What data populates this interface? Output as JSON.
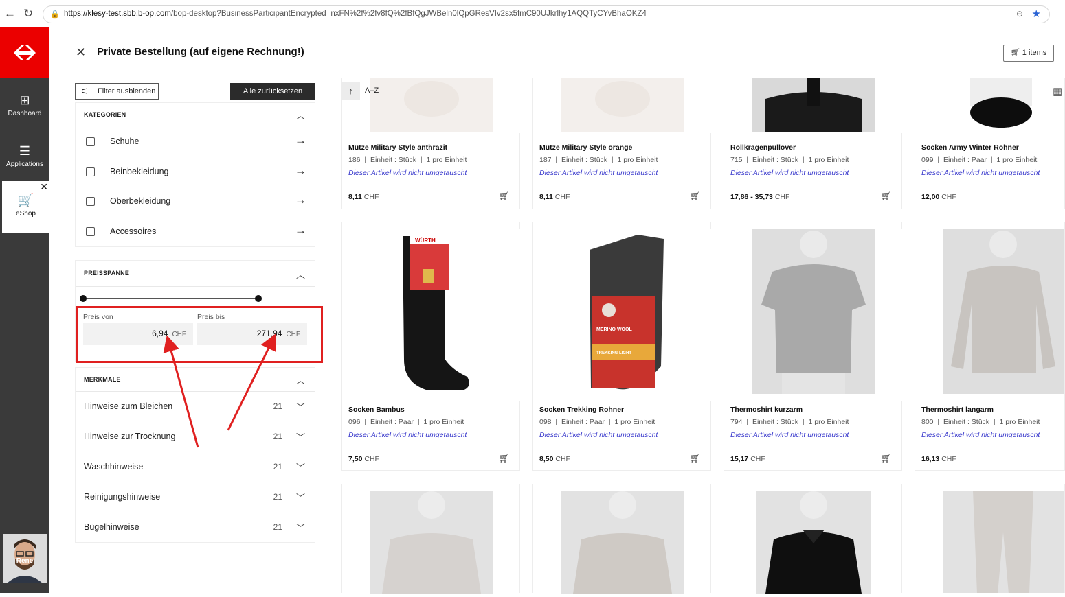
{
  "browser": {
    "url_host": "https://klesy-test.sbb.b-op.com",
    "url_path": "/bop-desktop?BusinessParticipantEncrypted=nxFN%2f%2fv8fQ%2fBfQgJWBeln0lQpGResVIv2sx5fmC90UJkrlhy1AQQTyCYvBhaOKZ4"
  },
  "rail": {
    "items": [
      {
        "label": "Dashboard",
        "icon": "dashboard-icon"
      },
      {
        "label": "Applications",
        "icon": "menu-icon"
      }
    ],
    "active": {
      "label": "eShop",
      "icon": "cart-icon"
    },
    "user": "Rene"
  },
  "header": {
    "title": "Private Bestellung (auf eigene Rechnung!)",
    "cart_label": "1 items"
  },
  "filters": {
    "toggle_label": "Filter ausblenden",
    "reset_label": "Alle zurücksetzen",
    "categories": {
      "title": "KATEGORIEN",
      "items": [
        "Schuhe",
        "Beinbekleidung",
        "Oberbekleidung",
        "Accessoires"
      ]
    },
    "price": {
      "title": "PREISSPANNE",
      "from_label": "Preis von",
      "to_label": "Preis bis",
      "from_value": "6,94",
      "to_value": "271,94",
      "currency": "CHF"
    },
    "features": {
      "title": "MERKMALE",
      "items": [
        {
          "label": "Hinweise zum Bleichen",
          "count": "21"
        },
        {
          "label": "Hinweise zur Trocknung",
          "count": "21"
        },
        {
          "label": "Waschhinweise",
          "count": "21"
        },
        {
          "label": "Reinigungshinweise",
          "count": "21"
        },
        {
          "label": "Bügelhinweise",
          "count": "21"
        }
      ]
    }
  },
  "sort": {
    "label": "A–Z"
  },
  "products": [
    {
      "name": "Mütze Military Style anthrazit",
      "code": "186",
      "unit": "Einheit : Stück",
      "per": "1 pro Einheit",
      "note": "Dieser Artikel wird nicht umgetauscht",
      "price": "8,11",
      "currency": "CHF"
    },
    {
      "name": "Mütze Military Style orange",
      "code": "187",
      "unit": "Einheit : Stück",
      "per": "1 pro Einheit",
      "note": "Dieser Artikel wird nicht umgetauscht",
      "price": "8,11",
      "currency": "CHF"
    },
    {
      "name": "Rollkragenpullover",
      "code": "715",
      "unit": "Einheit : Stück",
      "per": "1 pro Einheit",
      "note": "Dieser Artikel wird nicht umgetauscht",
      "price": "17,86 - 35,73",
      "currency": "CHF"
    },
    {
      "name": "Socken Army Winter Rohner",
      "code": "099",
      "unit": "Einheit : Paar",
      "per": "1 pro Einheit",
      "note": "Dieser Artikel wird nicht umgetauscht",
      "price": "12,00",
      "currency": "CHF"
    },
    {
      "name": "Socken Bambus",
      "code": "096",
      "unit": "Einheit : Paar",
      "per": "1 pro Einheit",
      "note": "Dieser Artikel wird nicht umgetauscht",
      "price": "7,50",
      "currency": "CHF"
    },
    {
      "name": "Socken Trekking Rohner",
      "code": "098",
      "unit": "Einheit : Paar",
      "per": "1 pro Einheit",
      "note": "Dieser Artikel wird nicht umgetauscht",
      "price": "8,50",
      "currency": "CHF"
    },
    {
      "name": "Thermoshirt kurzarm",
      "code": "794",
      "unit": "Einheit : Stück",
      "per": "1 pro Einheit",
      "note": "Dieser Artikel wird nicht umgetauscht",
      "price": "15,17",
      "currency": "CHF"
    },
    {
      "name": "Thermoshirt langarm",
      "code": "800",
      "unit": "Einheit : Stück",
      "per": "1 pro Einheit",
      "note": "Dieser Artikel wird nicht umgetauscht",
      "price": "16,13",
      "currency": "CHF"
    }
  ],
  "product_images": {
    "sock_brand": "WÜRTH",
    "sock_label": "MERINO WOOL",
    "sock_label2": "TREKKING LIGHT"
  },
  "colors": {
    "brand_red": "#eb0000",
    "annotation_red": "#e02020",
    "note_blue": "#3a3acc"
  }
}
